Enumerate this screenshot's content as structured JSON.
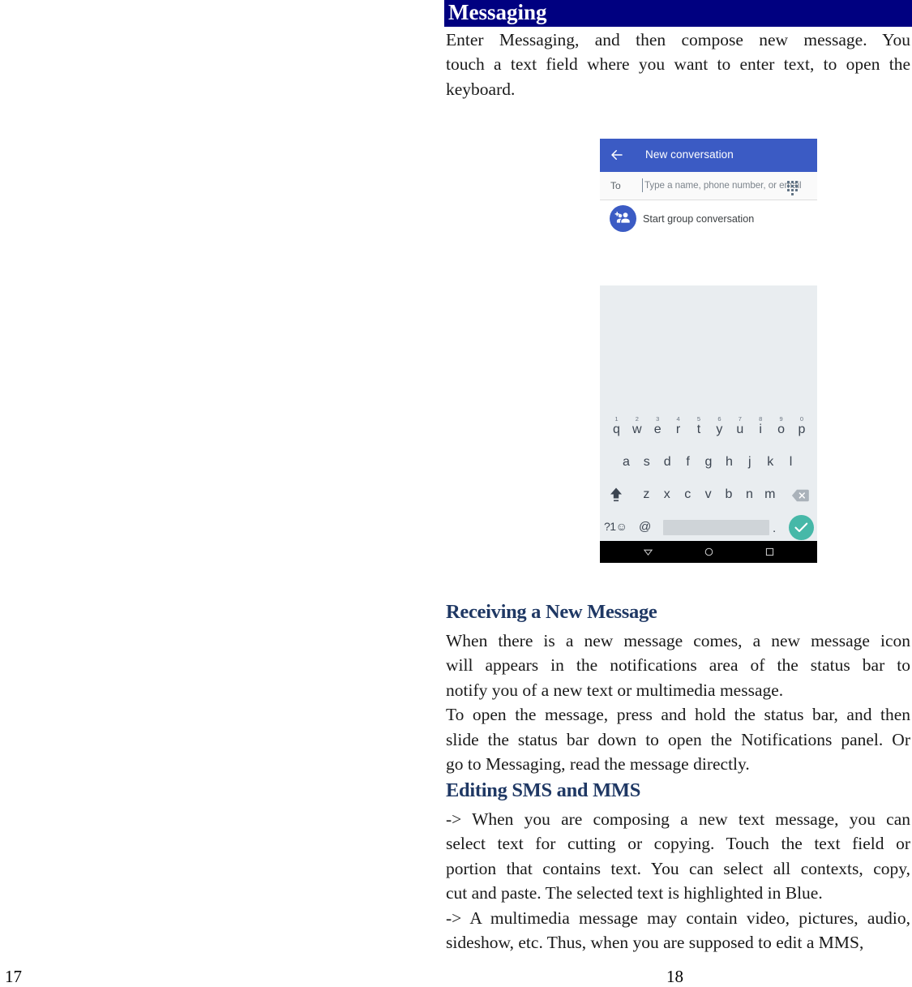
{
  "document": {
    "banner_title": "Messaging",
    "page_number_left": "17",
    "page_number_right": "18",
    "banner_bg": "#000080",
    "heading_color": "#1F3864",
    "intro_paragraph": {
      "line1": "Enter Messaging, and then compose new message. You",
      "line2": "touch a text field where you want to enter text, to open the",
      "line3": "keyboard."
    },
    "section_receiving": {
      "heading": "Receiving a New Message",
      "line1": "When there is a new message comes, a new message icon",
      "line2": "will appears in the notifications area of the status bar to",
      "line3": "notify you of a new text or multimedia message.",
      "line4": "To open the message, press and hold the status bar, and then",
      "line5": "slide the status bar down to open the Notifications panel. Or",
      "line6": "go to Messaging, read the message directly."
    },
    "section_editing": {
      "heading": "Editing SMS and MMS",
      "line1": "-> When you are composing a new text message, you can",
      "line2": "select text for cutting or copying. Touch the text field or",
      "line3": "portion that contains text. You can select all contexts, copy,",
      "line4": "cut and paste. The selected text is highlighted in Blue.",
      "line5": "-> A multimedia message may contain video, pictures, audio,",
      "line6": "sideshow, etc. Thus, when you are supposed to edit a MMS,"
    }
  },
  "phone_screenshot": {
    "appbar": {
      "back_icon": "arrow-left-icon",
      "title": "New conversation",
      "bg_color": "#3b5bc4"
    },
    "recipient_row": {
      "label": "To",
      "placeholder": "Type a name, phone number, or email",
      "value": "",
      "dialpad_icon": "dialpad-icon"
    },
    "group_row": {
      "avatar_icon": "add-group-icon",
      "label": "Start group conversation",
      "avatar_color": "#3b5bc4"
    },
    "keyboard": {
      "bg_color": "#e9edf0",
      "row1": [
        {
          "key": "q",
          "num": "1"
        },
        {
          "key": "w",
          "num": "2"
        },
        {
          "key": "e",
          "num": "3"
        },
        {
          "key": "r",
          "num": "4"
        },
        {
          "key": "t",
          "num": "5"
        },
        {
          "key": "y",
          "num": "6"
        },
        {
          "key": "u",
          "num": "7"
        },
        {
          "key": "i",
          "num": "8"
        },
        {
          "key": "o",
          "num": "9"
        },
        {
          "key": "p",
          "num": "0"
        }
      ],
      "row2": [
        "a",
        "s",
        "d",
        "f",
        "g",
        "h",
        "j",
        "k",
        "l"
      ],
      "row3": {
        "shift_icon": "shift-icon",
        "keys": [
          "z",
          "x",
          "c",
          "v",
          "b",
          "n",
          "m"
        ],
        "delete_icon": "backspace-icon"
      },
      "row4": {
        "symbols_label": "?1",
        "emoji_icon": "smiley-icon",
        "at_label": "@",
        "space_label": "",
        "period_label": ".",
        "enter_icon": "check-icon",
        "enter_color": "#46b8a8"
      }
    },
    "navbar": {
      "back_icon": "nav-back-triangle-icon",
      "home_icon": "nav-home-circle-icon",
      "recents_icon": "nav-recents-square-icon",
      "bg_color": "#000000"
    }
  }
}
